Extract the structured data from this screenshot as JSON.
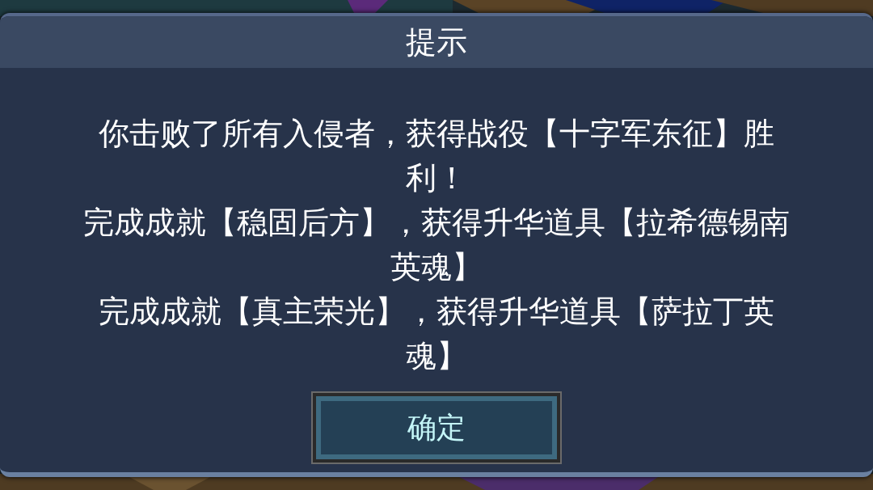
{
  "dialog": {
    "title": "提示",
    "messages": [
      "你击败了所有入侵者，获得战役【十字军东征】胜利！",
      "完成成就【稳固后方】，获得升华道具【拉希德锡南英魂】",
      "完成成就【真主荣光】，获得升华道具【萨拉丁英魂】"
    ],
    "buttons": [
      "确定"
    ]
  }
}
